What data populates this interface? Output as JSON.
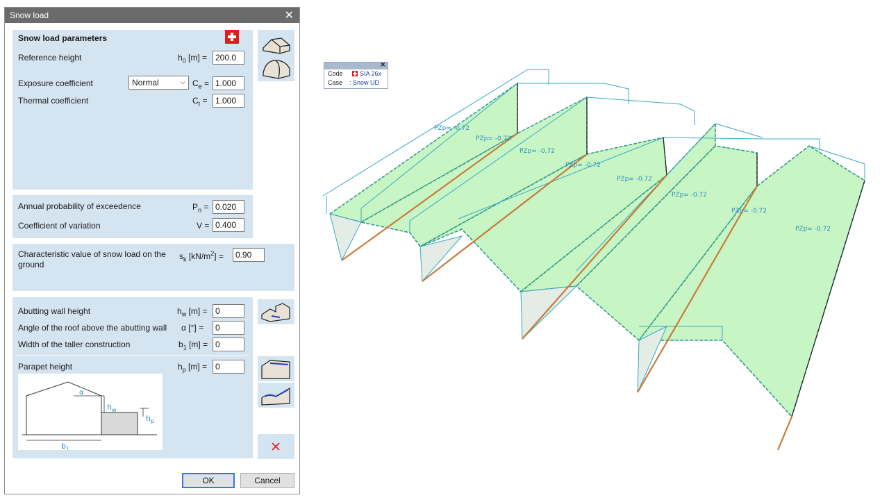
{
  "dialog": {
    "title": "Snow load",
    "section1": {
      "heading": "Snow load parameters",
      "reference_height": {
        "label": "Reference height",
        "symbol": "h",
        "sub": "0",
        "unit": "[m] =",
        "value": "200.0"
      },
      "exposure": {
        "label": "Exposure coefficient",
        "option": "Normal",
        "symbol": "C",
        "sub": "e",
        "unit": "=",
        "value": "1.000"
      },
      "thermal": {
        "label": "Thermal coefficient",
        "symbol": "C",
        "sub": "t",
        "unit": "=",
        "value": "1.000"
      }
    },
    "section2": {
      "annual": {
        "label": "Annual probability of exceedence",
        "symbol": "P",
        "sub": "n",
        "unit": "=",
        "value": "0.020"
      },
      "variation": {
        "label": "Coefficient of variation",
        "symbol": "V",
        "unit": "=",
        "value": "0.400"
      }
    },
    "section3": {
      "label_line1": "Characteristic value of snow load on the",
      "label_line2": "ground",
      "symbol": "s",
      "sub": "k",
      "unit": "[kN/m",
      "sup": "2",
      "unit_end": "] =",
      "value": "0.90"
    },
    "section4": {
      "wall_height": {
        "label": "Abutting wall height",
        "symbol": "h",
        "sub": "w",
        "unit": "[m] =",
        "value": "0"
      },
      "angle": {
        "label": "Angle of the roof above the abutting wall",
        "symbol": "α",
        "unit": "[°] =",
        "value": "0"
      },
      "width": {
        "label": "Width of the taller construction",
        "symbol": "b",
        "sub": "1",
        "unit": "[m] =",
        "value": "0"
      },
      "parapet": {
        "label": "Parapet height",
        "symbol": "h",
        "sub": "p",
        "unit": "[m] =",
        "value": "0"
      }
    },
    "diagram": {
      "alpha": "α",
      "hw": "h",
      "hw_sub": "w",
      "hp": "h",
      "hp_sub": "p",
      "b1": "b",
      "b1_sub": "1"
    },
    "buttons": {
      "ok": "OK",
      "cancel": "Cancel"
    },
    "colors": {
      "panel": "#d5e4f1",
      "title_bar": "#6b6b6b",
      "ok_border": "#3b78d8",
      "flag": "#e31d1d"
    }
  },
  "info_box": {
    "code_label": "Code",
    "code_value": "SIA 26x",
    "case_label": "Case",
    "case_value": ": Snow UD"
  },
  "model": {
    "labels": [
      "PZp= -0.72",
      "PZp= -0.72",
      "PZp= -0.72",
      "PZp= -0.72",
      "PZp= -0.72",
      "PZp= -0.72",
      "PZp= -0.72",
      "PZp= -0.72"
    ],
    "colors": {
      "fill": "#c8f5c4",
      "outline": "#37a8c8",
      "label": "#2a8fc0",
      "column": "#c87a3a"
    }
  }
}
